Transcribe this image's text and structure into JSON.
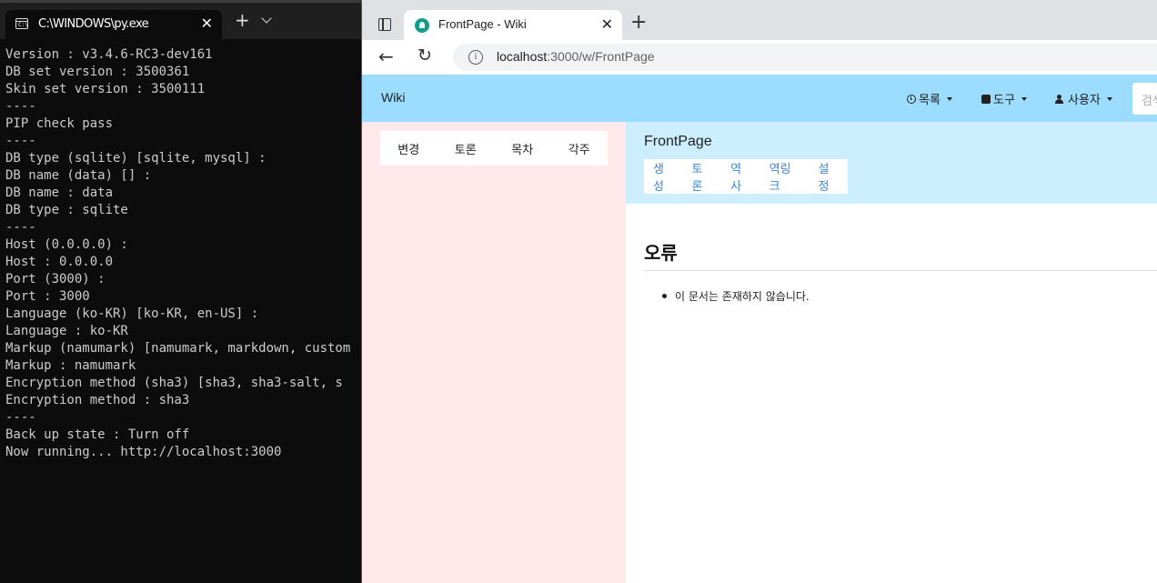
{
  "terminal": {
    "tab_title": "C:\\WINDOWS\\py.exe",
    "tab_icon": "terminal-icon",
    "icon_text": "C:\\",
    "lines": [
      "Version : v3.4.6-RC3-dev161",
      "DB set version : 3500361",
      "Skin set version : 3500111",
      "----",
      "PIP check pass",
      "----",
      "DB type (sqlite) [sqlite, mysql] :",
      "DB name (data) [] :",
      "DB name : data",
      "DB type : sqlite",
      "----",
      "Host (0.0.0.0) :",
      "Host : 0.0.0.0",
      "Port (3000) :",
      "Port : 3000",
      "Language (ko-KR) [ko-KR, en-US] :",
      "Language : ko-KR",
      "Markup (namumark) [namumark, markdown, custom",
      "Markup : namumark",
      "Encryption method (sha3) [sha3, sha3-salt, s",
      "Encryption method : sha3",
      "----",
      "Back up state : Turn off",
      "Now running... http://localhost:3000"
    ]
  },
  "browser": {
    "tab_title": "FrontPage - Wiki",
    "url_host": "localhost",
    "url_rest": ":3000/w/FrontPage"
  },
  "wiki": {
    "brand": "Wiki",
    "nav": {
      "list_label": "목록",
      "tools_label": "도구",
      "user_label": "사용자",
      "search_placeholder": "검색"
    },
    "sidebar_menu": [
      "변경",
      "토론",
      "목차",
      "각주"
    ],
    "doc_title": "FrontPage",
    "doc_menu": [
      "생성",
      "토론",
      "역사",
      "역링크",
      "설정"
    ],
    "error_title": "오류",
    "error_message": "이 문서는 존재하지 않습니다.",
    "colors": {
      "navbar": "#9bdcff",
      "sidebar": "#ffe9ea",
      "header": "#cceeff",
      "link": "#3a86d8"
    }
  }
}
